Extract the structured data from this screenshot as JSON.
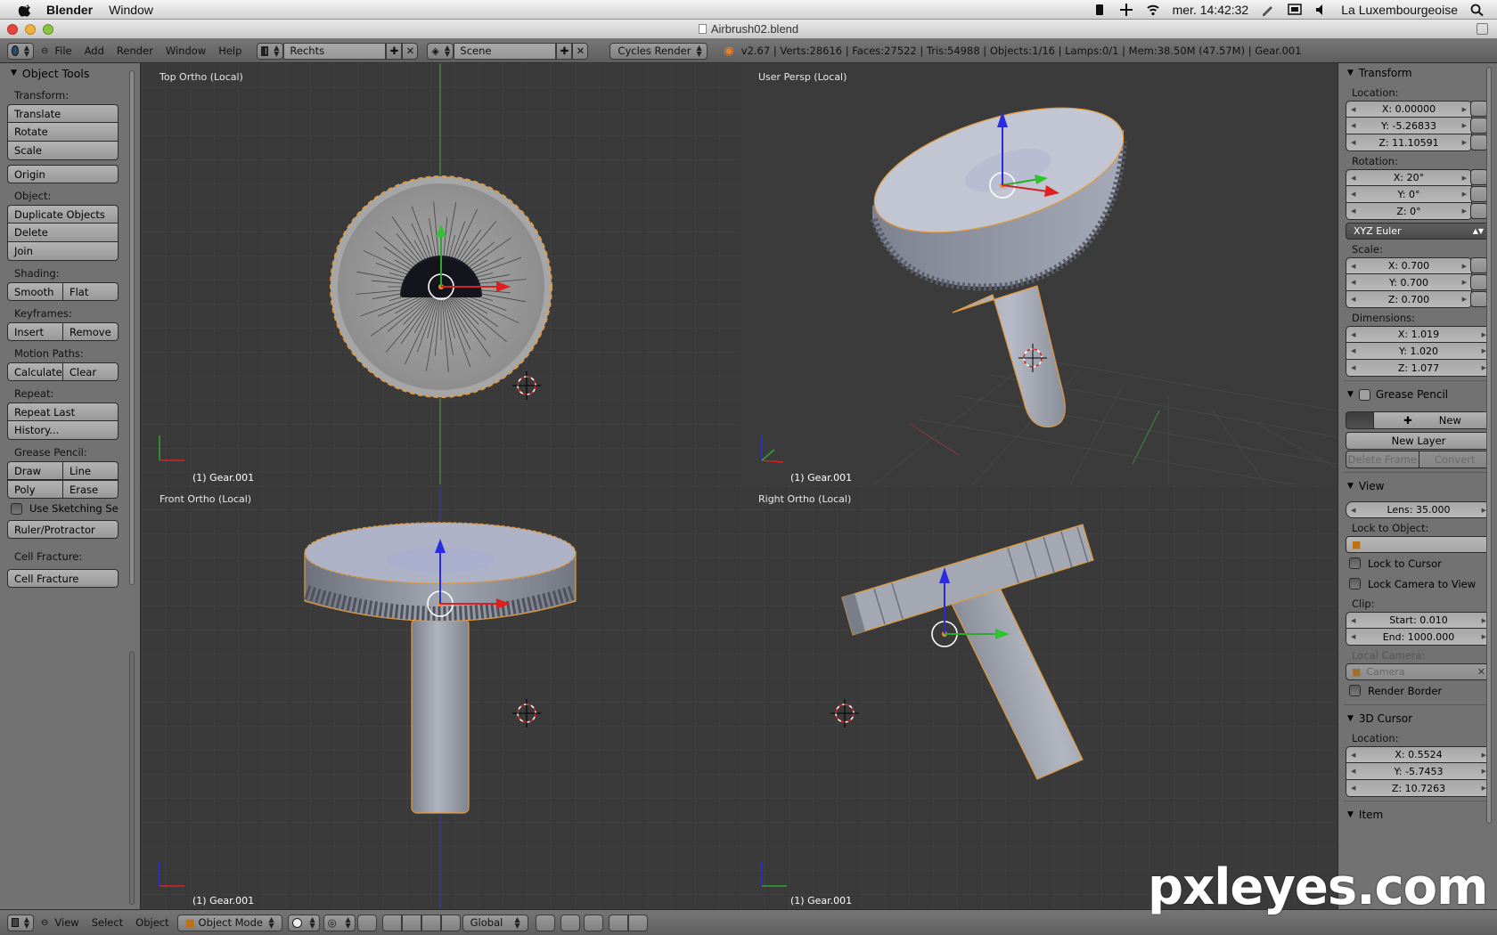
{
  "macos": {
    "app_name": "Blender",
    "menus": [
      "Window"
    ],
    "clock": "mer. 14:42:32",
    "location": "La Luxembourgeoise"
  },
  "window": {
    "title": "Airbrush02.blend"
  },
  "header": {
    "menus": [
      "File",
      "Add",
      "Render",
      "Window",
      "Help"
    ],
    "screen_layout": "Rechts",
    "scene": "Scene",
    "render_engine": "Cycles Render",
    "stats": "v2.67 | Verts:28616 | Faces:27522 | Tris:54988 | Objects:1/16 | Lamps:0/1 | Mem:38.50M (47.57M) | Gear.001"
  },
  "tool_shelf": {
    "title": "Object Tools",
    "transform_label": "Transform:",
    "translate": "Translate",
    "rotate": "Rotate",
    "scale": "Scale",
    "origin": "Origin",
    "object_label": "Object:",
    "duplicate": "Duplicate Objects",
    "delete": "Delete",
    "join": "Join",
    "shading_label": "Shading:",
    "smooth": "Smooth",
    "flat": "Flat",
    "keyframes_label": "Keyframes:",
    "insert": "Insert",
    "remove": "Remove",
    "motion_paths_label": "Motion Paths:",
    "calculate": "Calculate",
    "clear": "Clear",
    "repeat_label": "Repeat:",
    "repeat_last": "Repeat Last",
    "history": "History...",
    "grease_pencil_label": "Grease Pencil:",
    "draw": "Draw",
    "line": "Line",
    "poly": "Poly",
    "erase": "Erase",
    "use_sketching": "Use Sketching Se",
    "ruler": "Ruler/Protractor",
    "cell_fracture_label": "Cell Fracture:",
    "cell_fracture": "Cell Fracture"
  },
  "viewports": [
    {
      "label": "Top Ortho (Local)",
      "object": "(1) Gear.001"
    },
    {
      "label": "User Persp (Local)",
      "object": "(1) Gear.001"
    },
    {
      "label": "Front Ortho (Local)",
      "object": "(1) Gear.001"
    },
    {
      "label": "Right Ortho (Local)",
      "object": "(1) Gear.001"
    }
  ],
  "properties": {
    "transform_title": "Transform",
    "location_label": "Location:",
    "loc_x": "X: 0.00000",
    "loc_y": "Y: -5.26833",
    "loc_z": "Z: 11.10591",
    "rotation_label": "Rotation:",
    "rot_x": "X: 20°",
    "rot_y": "Y: 0°",
    "rot_z": "Z: 0°",
    "rotation_mode": "XYZ Euler",
    "scale_label": "Scale:",
    "scale_x": "X: 0.700",
    "scale_y": "Y: 0.700",
    "scale_z": "Z: 0.700",
    "dimensions_label": "Dimensions:",
    "dim_x": "X: 1.019",
    "dim_y": "Y: 1.020",
    "dim_z": "Z: 1.077",
    "grease_pencil_title": "Grease Pencil",
    "gp_new": "New",
    "new_layer": "New Layer",
    "delete_frame": "Delete Frame",
    "convert": "Convert",
    "view_title": "View",
    "lens": "Lens: 35.000",
    "lock_to_object_label": "Lock to Object:",
    "lock_to_cursor": "Lock to Cursor",
    "lock_camera": "Lock Camera to View",
    "clip_label": "Clip:",
    "clip_start": "Start: 0.010",
    "clip_end": "End: 1000.000",
    "local_camera_label": "Local Camera:",
    "camera": "Camera",
    "render_border": "Render Border",
    "cursor_title": "3D Cursor",
    "cursor_location_label": "Location:",
    "cur_x": "X: 0.5524",
    "cur_y": "Y: -5.7453",
    "cur_z": "Z: 10.7263",
    "item_title": "Item"
  },
  "bottom": {
    "menus": [
      "View",
      "Select",
      "Object"
    ],
    "mode": "Object Mode",
    "orientation": "Global"
  },
  "watermark": "pxleyes.com"
}
